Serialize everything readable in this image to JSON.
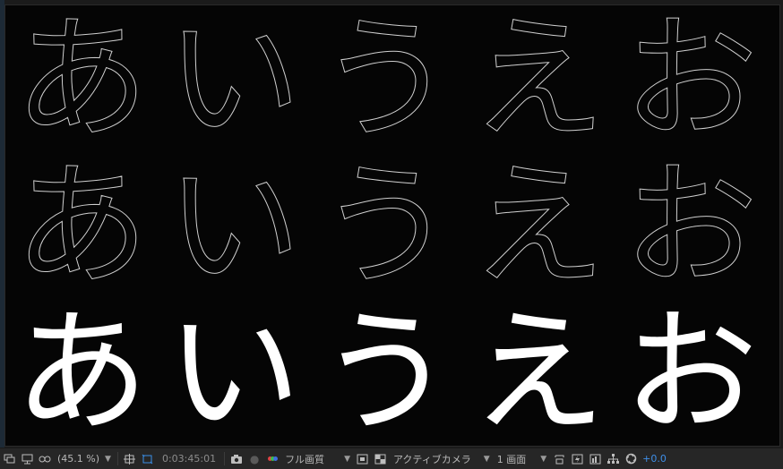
{
  "canvas": {
    "rows": [
      {
        "style": "outline",
        "chars": [
          "あ",
          "い",
          "う",
          "え",
          "お"
        ]
      },
      {
        "style": "outline",
        "chars": [
          "あ",
          "い",
          "う",
          "え",
          "お"
        ]
      },
      {
        "style": "solid",
        "chars": [
          "あ",
          "い",
          "う",
          "え",
          "お"
        ]
      }
    ]
  },
  "toolbar": {
    "zoom": "(45.1 %)",
    "timecode": "0:03:45:01",
    "resolution": "フル画質",
    "camera": "アクティブカメラ",
    "views": "1 画面",
    "exposure": "+0.0"
  },
  "colors": {
    "accent": "#3f8fe8",
    "canvas_bg": "#050505",
    "toolbar_bg": "#262626"
  }
}
